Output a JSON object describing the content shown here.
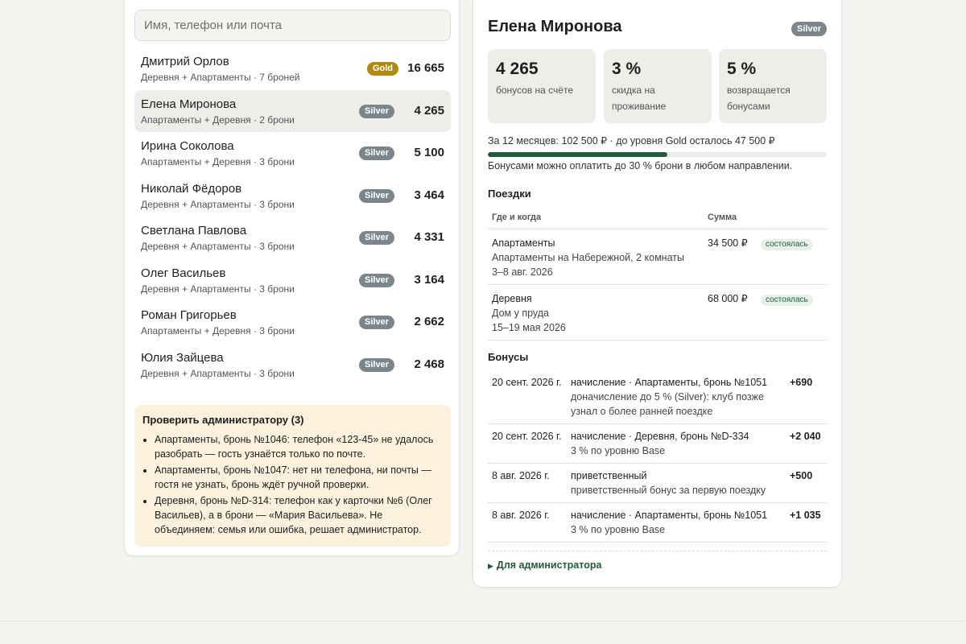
{
  "search": {
    "placeholder": "Имя, телефон или почта"
  },
  "clients": [
    {
      "name": "Дмитрий Орлов",
      "sub": "Деревня + Апартаменты · 7 броней",
      "tier": "Gold",
      "points": "16 665"
    },
    {
      "name": "Елена Миронова",
      "sub": "Апартаменты + Деревня · 2 брони",
      "tier": "Silver",
      "points": "4 265"
    },
    {
      "name": "Ирина Соколова",
      "sub": "Апартаменты + Деревня · 3 брони",
      "tier": "Silver",
      "points": "5 100"
    },
    {
      "name": "Николай Фёдоров",
      "sub": "Деревня + Апартаменты · 3 брони",
      "tier": "Silver",
      "points": "3 464"
    },
    {
      "name": "Светлана Павлова",
      "sub": "Деревня + Апартаменты · 3 брони",
      "tier": "Silver",
      "points": "4 331"
    },
    {
      "name": "Олег Васильев",
      "sub": "Деревня + Апартаменты · 3 брони",
      "tier": "Silver",
      "points": "3 164"
    },
    {
      "name": "Роман Григорьев",
      "sub": "Апартаменты + Деревня · 3 брони",
      "tier": "Silver",
      "points": "2 662"
    },
    {
      "name": "Юлия Зайцева",
      "sub": "Деревня + Апартаменты · 3 брони",
      "tier": "Silver",
      "points": "2 468"
    }
  ],
  "selected_client_index": 1,
  "admin_check": {
    "title": "Проверить администратору (3)",
    "items": [
      "Апартаменты, бронь №1046: телефон «123-45» не удалось разобрать — гость узнаётся только по почте.",
      "Апартаменты, бронь №1047: нет ни телефона, ни почты — гостя не узнать, бронь ждёт ручной проверки.",
      "Деревня, бронь №D-314: телефон как у карточки №6 (Олег Васильев), а в брони — «Мария Васильева». Не объединяем: семья или ошибка, решает администратор."
    ]
  },
  "profile": {
    "name": "Елена Миронова",
    "tier": "Silver",
    "stats": [
      {
        "value": "4 265",
        "label": "бонусов на счёте"
      },
      {
        "value": "3 %",
        "label": "скидка на проживание"
      },
      {
        "value": "5 %",
        "label": "возвращается бонусами"
      }
    ],
    "progress_text": "За 12 месяцев: 102 500 ₽ · до уровня Gold осталось 47 500 ₽",
    "progress_fraction": 0.53,
    "progress_note": "Бонусами можно оплатить до 30 % брони в любом направлении."
  },
  "trips": {
    "title": "Поездки",
    "col_where": "Где и когда",
    "col_sum": "Сумма",
    "rows": [
      {
        "place": "Апартаменты",
        "desc": "Апартаменты на Набережной, 2 комнаты",
        "dates": "3–8 авг. 2026",
        "sum": "34 500 ₽",
        "status": "состоялась"
      },
      {
        "place": "Деревня",
        "desc": "Дом у пруда",
        "dates": "15–19 мая 2026",
        "sum": "68 000 ₽",
        "status": "состоялась"
      }
    ]
  },
  "bonuses": {
    "title": "Бонусы",
    "rows": [
      {
        "date": "20 сент. 2026 г.",
        "main": "начисление · Апартаменты, бронь №1051",
        "sub": "доначисление до 5 % (Silver): клуб позже узнал о более ранней поездке",
        "amount": "+690"
      },
      {
        "date": "20 сент. 2026 г.",
        "main": "начисление · Деревня, бронь №D-334",
        "sub": "3 % по уровню Base",
        "amount": "+2 040"
      },
      {
        "date": "8 авг. 2026 г.",
        "main": "приветственный",
        "sub": "приветственный бонус за первую поездку",
        "amount": "+500"
      },
      {
        "date": "8 авг. 2026 г.",
        "main": "начисление · Апартаменты, бронь №1051",
        "sub": "3 % по уровню Base",
        "amount": "+1 035"
      }
    ]
  },
  "admin_toggle": {
    "label": "Для администратора",
    "icon": "triangle-right-icon"
  },
  "colors": {
    "accent": "#235a3c",
    "gold": "#b38a10",
    "silver": "#7b858c",
    "warning_bg": "#fbf1dd"
  }
}
